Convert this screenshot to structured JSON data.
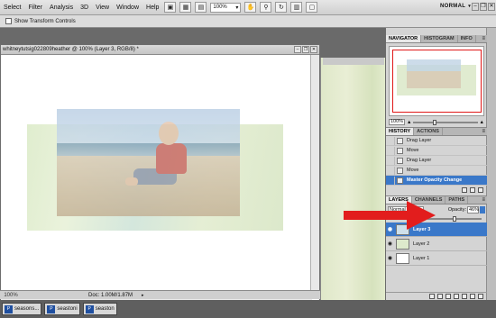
{
  "menu": [
    "Select",
    "Filter",
    "Analysis",
    "3D",
    "View",
    "Window",
    "Help"
  ],
  "toolbar": {
    "zoom": "100%",
    "workspace": "NORMAL"
  },
  "options_bar": {
    "show_transform_label": "Show Transform Controls"
  },
  "document": {
    "title": "whitneytutsig022809heather @ 100% (Layer 3, RGB/8) *",
    "status_zoom": "100%",
    "status_doc": "Doc: 1.00M/1.87M"
  },
  "navigator": {
    "tabs": [
      "NAVIGATOR",
      "HISTOGRAM",
      "INFO"
    ],
    "zoom": "100%",
    "zoom_slider_fraction": 0.3
  },
  "history": {
    "tabs": [
      "HISTORY",
      "ACTIONS"
    ],
    "items": [
      "Drag Layer",
      "Move",
      "Drag Layer",
      "Move",
      "Master Opacity Change"
    ],
    "selected_index": 4
  },
  "layers": {
    "tabs": [
      "LAYERS",
      "CHANNELS",
      "PATHS"
    ],
    "blend_mode": "Normal",
    "opacity_label": "Opacity:",
    "opacity_value": "46%",
    "opacity_fraction": 0.46,
    "items": [
      "Layer 3",
      "Layer 2",
      "Layer 1"
    ],
    "selected_index": 0
  },
  "taskbar": [
    "seasons...",
    "seastoni",
    "seaston"
  ],
  "colors": {
    "selection": "#3a78c9",
    "annotation_red": "#e21d1d",
    "navigator_frame": "#e01818"
  }
}
